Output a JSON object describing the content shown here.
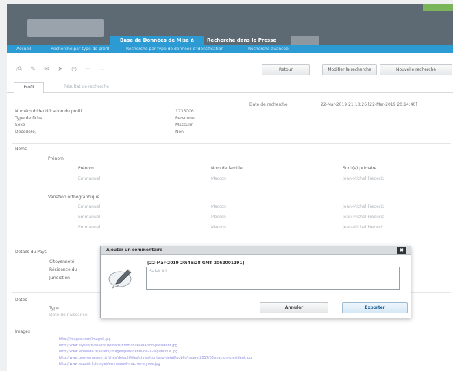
{
  "header": {
    "badge": "",
    "tabs": [
      {
        "label": "Base de Données de Mise à"
      },
      {
        "label": "Recherche dans le Presse"
      }
    ]
  },
  "nav": {
    "links": [
      {
        "label": "Accueil"
      },
      {
        "label": "Recherche par type de profil"
      },
      {
        "label": "Recherche par type de données d'identification"
      },
      {
        "label": "Recherche avancée"
      }
    ]
  },
  "toolbar": {
    "icons": [
      "print-icon",
      "edit-icon",
      "mail-icon",
      "pin-icon",
      "clock-icon",
      "minus-icon",
      "dash-icon"
    ],
    "buttons": [
      {
        "label": "Retour"
      },
      {
        "label": "Modifier la recherche"
      },
      {
        "label": "Nouvelle recherche"
      }
    ]
  },
  "view_tabs": {
    "active": "Profil",
    "inactive": "Résultat de recherche"
  },
  "date_range": {
    "label": "Date de recherche",
    "value": "22-Mar-2019 21:13:26 [22-Mar-2019 20:14:40]"
  },
  "profile": {
    "rows": [
      {
        "label": "Numéro d'identification du profil",
        "value": "1735006"
      },
      {
        "label": "Type de fiche",
        "value": "Personne"
      },
      {
        "label": "Sexe",
        "value": "Masculin"
      },
      {
        "label": "Décédé(e)",
        "value": "Non"
      }
    ]
  },
  "names": {
    "section": "Noms",
    "primary_title": "Prénom",
    "columns": [
      "Prénom",
      "Nom de famille",
      "Sorti(e) primaire"
    ],
    "primary_rows": [
      [
        "Emmanuel",
        "Macron",
        "Jean-Michel Frederic"
      ]
    ],
    "variants_title": "Variation orthographique",
    "variant_rows": [
      [
        "Emmanuel",
        "Macron",
        "Jean-Michel Frederic"
      ],
      [
        "Emmanuel",
        "Macron",
        "Jean-Michel Frederic"
      ],
      [
        "Emmanuel",
        "Macron",
        "Jean-Michel Frederic"
      ]
    ]
  },
  "country": {
    "section": "Détails du Pays",
    "labels": [
      "Citoyenneté",
      "Résidence du",
      "Juridiction"
    ]
  },
  "dates": {
    "section": "Dates",
    "type_label": "Type",
    "type_value": "Date de naissance"
  },
  "images": {
    "section": "Images",
    "urls": [
      "http://images.com/image6.jpg",
      "http://www.elysee.fr/assets/Uploads/Emmanuel-Macron-president.jpg",
      "http://www.lemonde.fr/assets/images/presidents-de-la-republique.jpg",
      "http://www.gouvernement.fr/sites/default/files/styles/contenu-detail/public/image/2017/05/macron-president.jpg",
      "http://www.lepoint.fr/images/emmanuel-macron-elysee.jpg"
    ]
  },
  "dialog": {
    "title": "Ajouter un commentaire",
    "close_icon": "close-icon",
    "date": "[22-Mar-2019 20:45:28 GMT 2062001191]",
    "placeholder": "Saisir ici",
    "cancel_label": "Annuler",
    "export_label": "Exporter"
  },
  "colors": {
    "header": "#5d6a74",
    "accent": "#2c9ad3",
    "badge": "#7ab55c",
    "link": "#8e8ee0"
  }
}
